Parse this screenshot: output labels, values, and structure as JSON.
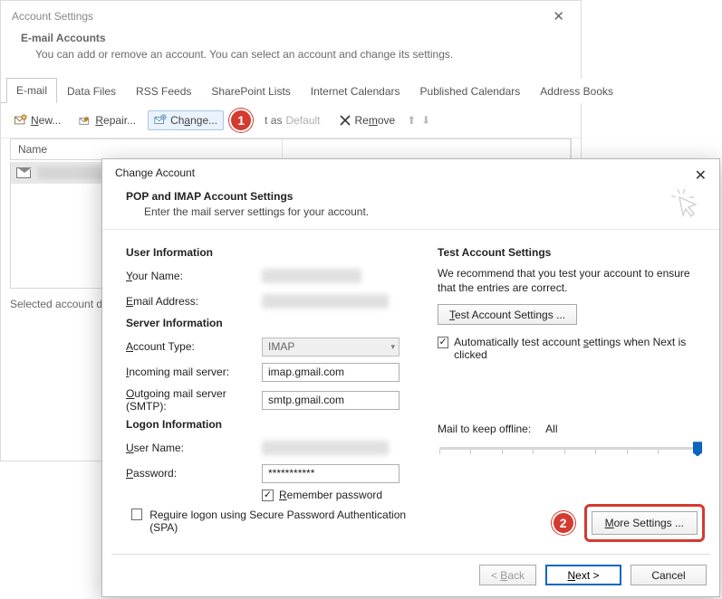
{
  "back": {
    "title": "Account Settings",
    "header_title": "E-mail Accounts",
    "header_sub": "You can add or remove an account. You can select an account and change its settings.",
    "tabs": [
      "E-mail",
      "Data Files",
      "RSS Feeds",
      "SharePoint Lists",
      "Internet Calendars",
      "Published Calendars",
      "Address Books"
    ],
    "toolbar": {
      "new": "New...",
      "repair": "Repair...",
      "change": "Change...",
      "set_default_prefix": "t as ",
      "set_default_word": "Default",
      "remove": "Remove"
    },
    "callout1": "1",
    "list_col1": "Name",
    "selected_prefix": "Selected account de"
  },
  "front": {
    "title": "Change Account",
    "head_title": "POP and IMAP Account Settings",
    "head_sub": "Enter the mail server settings for your account.",
    "user_info": "User Information",
    "your_name_lbl_pre": "Y",
    "your_name_lbl_post": "our Name:",
    "email_lbl_pre": "E",
    "email_lbl_post": "mail Address:",
    "server_info": "Server Information",
    "acct_type_lbl_pre": "A",
    "acct_type_lbl_post": "ccount Type:",
    "acct_type_value": "IMAP",
    "incoming_lbl_pre": "I",
    "incoming_lbl_post": "ncoming mail server:",
    "incoming_value": "imap.gmail.com",
    "outgoing_lbl_pre": "O",
    "outgoing_lbl_post": "utgoing mail server (SMTP):",
    "outgoing_value": "smtp.gmail.com",
    "logon_info": "Logon Information",
    "username_lbl_pre": "U",
    "username_lbl_post": "ser Name:",
    "password_lbl_pre": "P",
    "password_lbl_post": "assword:",
    "password_value": "***********",
    "remember_pw_pre": "R",
    "remember_pw_post": "emember password",
    "require_spa_pre": "Re",
    "require_spa_mid": "q",
    "require_spa_post": "uire logon using Secure Password Authentication (SPA)",
    "test_title": "Test Account Settings",
    "test_note": "We recommend that you test your account to ensure that the entries are correct.",
    "test_btn_pre": "T",
    "test_btn_post": "est Account Settings ...",
    "auto_test_pre": "Automatically test account ",
    "auto_test_u": "s",
    "auto_test_post": "ettings when Next is clicked",
    "mail_keep_label": "Mail to keep offline:",
    "mail_keep_value": "All",
    "callout2": "2",
    "more_btn_pre": "M",
    "more_btn_post": "ore Settings ...",
    "back_btn_pre": "< ",
    "back_btn_u": "B",
    "back_btn_post": "ack",
    "next_btn_pre": "N",
    "next_btn_post": "ext >",
    "cancel_btn": "Cancel"
  }
}
